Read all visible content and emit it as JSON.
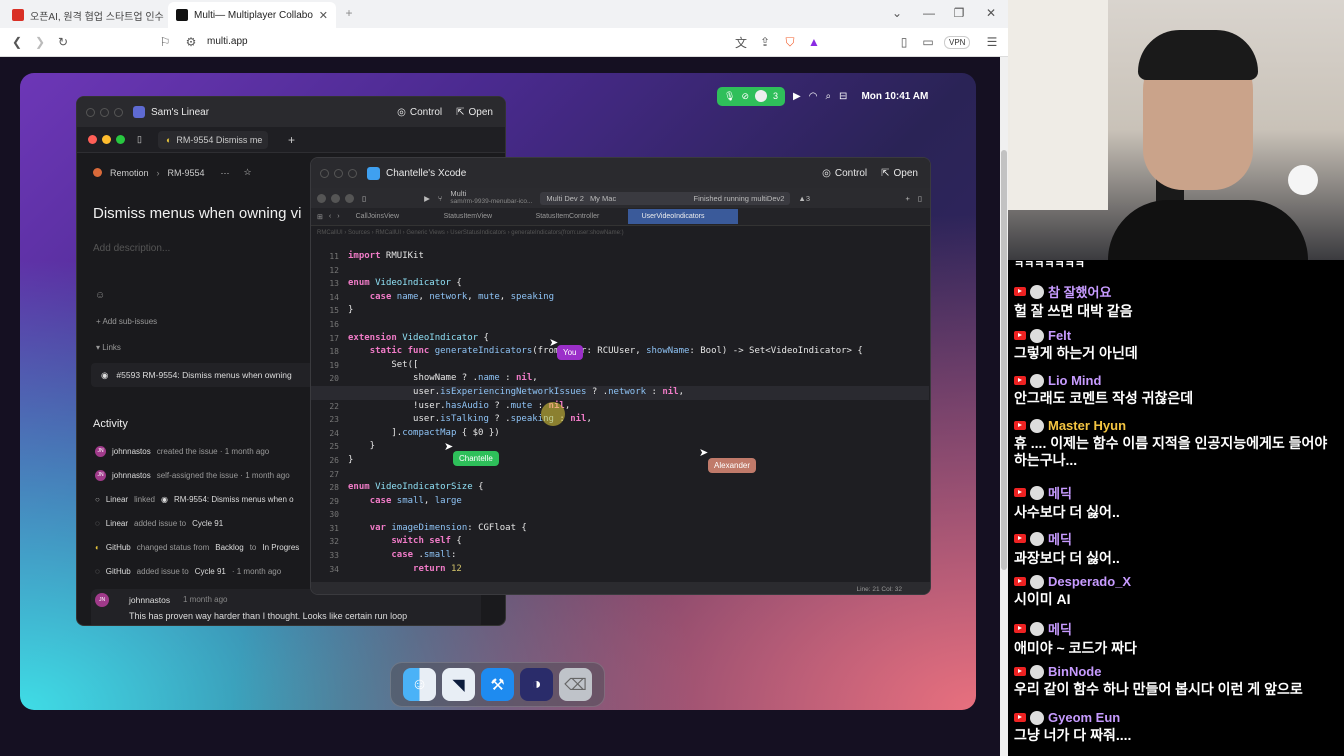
{
  "browser": {
    "tabs": [
      {
        "label": "오픈AI, 원격 협업 스타트업 인수...",
        "active": false
      },
      {
        "label": "Multi— Multiplayer Collaborati",
        "active": true
      }
    ],
    "new_tab": "+",
    "url": "multi.app",
    "vpn": "VPN"
  },
  "mac_status": {
    "participants": "3",
    "clock": "Mon 10:41 AM"
  },
  "linear_window": {
    "title": "Sam's Linear",
    "control": "Control",
    "open": "Open",
    "tab_label": "RM-9554 Dismiss me",
    "breadcrumb_team": "Remotion",
    "breadcrumb_issue": "RM-9554",
    "issue_title": "Dismiss menus when owning vi",
    "description_placeholder": "Add description...",
    "add_subissues": "+ Add sub-issues",
    "links_label": "▾ Links",
    "link_item": "#5593 RM-9554: Dismiss menus when owning",
    "activity_heading": "Activity",
    "activity": [
      {
        "actor": "johnnastos",
        "text": "created the issue · 1 month ago"
      },
      {
        "actor": "johnnastos",
        "text": "self-assigned the issue · 1 month ago"
      },
      {
        "actor": "Linear",
        "text": "linked",
        "extra": "RM-9554: Dismiss menus when o"
      },
      {
        "actor": "Linear",
        "text": "added issue to",
        "extra": "Cycle 91"
      },
      {
        "actor": "GitHub",
        "text": "changed status from",
        "extra": "Backlog",
        "extra2": "to",
        "extra3": "In Progres"
      },
      {
        "actor": "GitHub",
        "text": "added issue to",
        "extra": "Cycle 91",
        "extra2": "· 1 month ago"
      }
    ],
    "comment_author": "johnnastos",
    "comment_time": "1 month ago",
    "comment_text": "This has proven way harder than I thought. Looks like certain run loop"
  },
  "xcode_window": {
    "title": "Chantelle's Xcode",
    "control": "Control",
    "open": "Open",
    "scheme": "Multi",
    "branch": "sam/rm-9939-menubar-ico...",
    "destination": "Multi Dev 2",
    "device": "My Mac",
    "status": "Finished running multiDev2",
    "warnings": "▲3",
    "file_tabs": [
      "CallJoinsView",
      "StatusItemView",
      "StatusItemController",
      "UserVideoIndicators"
    ],
    "active_file": "UserVideoIndicators",
    "jump_bar": "RMCallUI › Sources › RMCallUI › Generic Views › UserStatusIndicators › generateIndicators(from:user:showName:)",
    "status_bar": "Line: 21  Col: 32",
    "line_numbers": [
      "11",
      "12",
      "13",
      "14",
      "15",
      "16",
      "17",
      "18",
      "19",
      "20",
      "21",
      "22",
      "23",
      "24",
      "25",
      "26",
      "27",
      "28",
      "29",
      "30",
      "31",
      "32",
      "33",
      "34"
    ],
    "cursors": {
      "you": "You",
      "chantelle": "Chantelle",
      "alexander": "Alexander"
    }
  },
  "dock": {
    "icons": [
      "finder-icon",
      "multi-icon",
      "xcode-icon",
      "linear-icon",
      "trash-icon"
    ]
  },
  "chat": {
    "top_partial": "ㅋㅋㅋㅋㅋㅋㅋ",
    "messages": [
      {
        "user": "참 잘했어요",
        "text": "헐 잘 쓰면 대박 같음",
        "color": "#c79bff"
      },
      {
        "user": "Felt",
        "text": "그렇게 하는거 아닌데",
        "color": "#c79bff"
      },
      {
        "user": "Lio Mind",
        "text": "안그래도 코멘트 작성 귀찮은데",
        "color": "#c79bff"
      },
      {
        "user": "Master Hyun",
        "text": "휴 .... 이제는 함수 이름 지적을 인공지능에게도 들어야 하는구나...",
        "color": "#f4c542"
      },
      {
        "user": "메딕",
        "text": "사수보다 더 싫어..",
        "color": "#c79bff"
      },
      {
        "user": "메딕",
        "text": "과장보다 더 싫어..",
        "color": "#c79bff"
      },
      {
        "user": "Desperado_X",
        "text": "시이미 AI",
        "color": "#c79bff"
      },
      {
        "user": "메딕",
        "text": "애미야 ~ 코드가 짜다",
        "color": "#c79bff"
      },
      {
        "user": "BinNode",
        "text": "우리 같이 함수 하나 만들어 봅시다 이런 게 앞으로",
        "color": "#c79bff"
      },
      {
        "user": "Gyeom Eun",
        "text": "그냥 너가 다 짜줘....",
        "color": "#c79bff"
      }
    ]
  }
}
